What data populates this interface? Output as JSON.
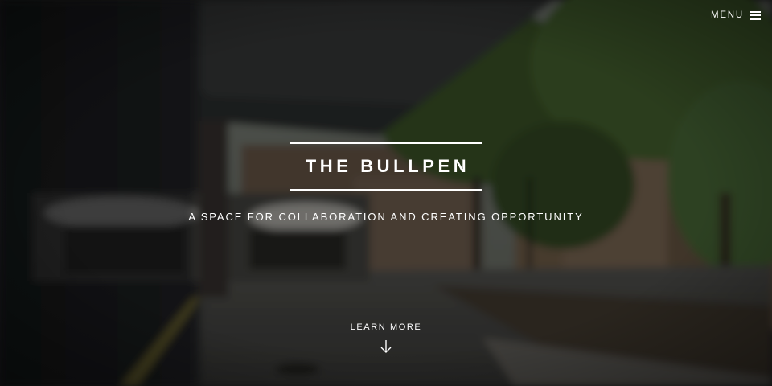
{
  "header": {
    "menu_label": "MENU",
    "menu_icon": "hamburger-icon"
  },
  "hero": {
    "title": "THE BULLPEN",
    "subtitle": "A SPACE FOR COLLABORATION AND CREATING OPPORTUNITY",
    "cta_label": "LEARN MORE",
    "cta_icon": "arrow-down-icon",
    "background_image": "blurred-courtyard-photo",
    "text_color": "#ffffff"
  }
}
